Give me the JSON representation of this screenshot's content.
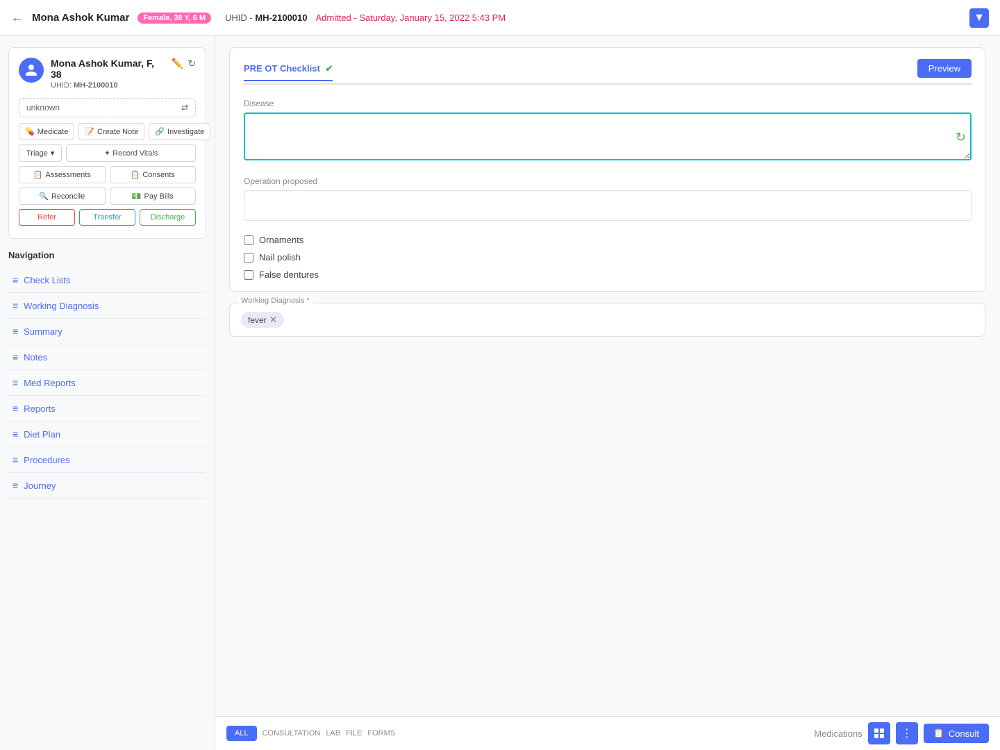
{
  "header": {
    "back_label": "←",
    "patient_name": "Mona Ashok Kumar",
    "patient_badge": "Female, 38 Y, 6 M",
    "uhid_prefix": "UHID -",
    "uhid": "MH-2100010",
    "admitted_label": "Admitted -",
    "admitted_date": "Saturday, January 15, 2022 5:43 PM",
    "nav_icon": "▼"
  },
  "sidebar": {
    "patient_name": "Mona Ashok Kumar, F, 38",
    "uhid_label": "UHID:",
    "uhid": "MH-2100010",
    "status": "unknown",
    "buttons": {
      "medicate": "Medicate",
      "create_note": "Create Note",
      "investigate": "Investigate",
      "triage": "Triage",
      "record_vitals": "✦ Record Vitals",
      "assessments": "Assessments",
      "consents": "Consents",
      "reconcile": "Reconcile",
      "pay_bills": "Pay Bills",
      "refer": "Refer",
      "transfer": "Transfer",
      "discharge": "Discharge"
    },
    "navigation": {
      "title": "Navigation",
      "items": [
        "Check Lists",
        "Working Diagnosis",
        "Summary",
        "Notes",
        "Med Reports",
        "Reports",
        "Diet Plan",
        "Procedures",
        "Journey"
      ]
    }
  },
  "main": {
    "tab": {
      "label": "PRE OT Checklist",
      "check_icon": "✔"
    },
    "preview_button": "Preview",
    "disease_label": "Disease",
    "operation_label": "Operation proposed",
    "checkboxes": [
      {
        "id": "ornaments",
        "label": "Ornaments",
        "checked": false
      },
      {
        "id": "nail_polish",
        "label": "Nail polish",
        "checked": false
      },
      {
        "id": "false_dentures",
        "label": "False dentures",
        "checked": false
      }
    ],
    "working_diagnosis": {
      "label": "Working Diagnosis *",
      "tag": "fever"
    }
  },
  "bottom_bar": {
    "tab_btn": "ALL",
    "tabs": [
      "CONSULTATION",
      "LAB",
      "FILE",
      "FORMS"
    ],
    "medications_label": "Medications",
    "consult_label": "Consult",
    "consult_icon": "📋"
  }
}
